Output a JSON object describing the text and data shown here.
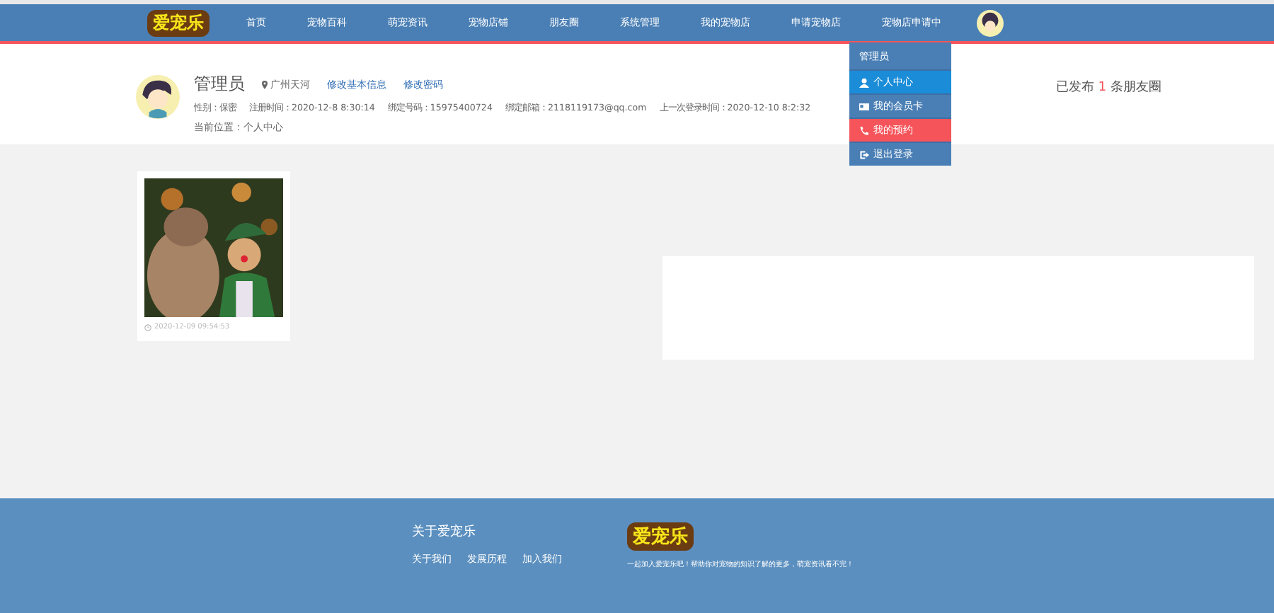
{
  "nav": {
    "logo": "爱宠乐",
    "items": [
      {
        "label": "首页",
        "selected": false
      },
      {
        "label": "宠物百科",
        "selected": false
      },
      {
        "label": "萌宠资讯",
        "selected": false
      },
      {
        "label": "宠物店铺",
        "selected": false
      },
      {
        "label": "朋友圈",
        "selected": false
      },
      {
        "label": "系统管理",
        "selected": false
      },
      {
        "label": "我的宠物店",
        "selected": false
      },
      {
        "label": "申请宠物店",
        "selected": false
      },
      {
        "label": "宠物店申请中",
        "selected": false
      }
    ]
  },
  "user_menu": {
    "title": "管理员",
    "items": [
      {
        "label": "个人中心",
        "color": "#1a8cd8"
      },
      {
        "label": "我的会员卡",
        "color": "#4a7fb5"
      },
      {
        "label": "我的预约",
        "color": "#f5545a"
      },
      {
        "label": "退出登录",
        "color": "#4a7fb5"
      }
    ]
  },
  "profile": {
    "name": "管理员",
    "location": "广州天河",
    "links": [
      "修改基本信息",
      "修改密码"
    ],
    "details": [
      "性别：保密",
      "注册时间：2020-12-8 8:30:14",
      "绑定号码：15975400724",
      "绑定邮箱：2118119173@qq.com",
      "上一次登录时间：2020-12-10 8:2:32"
    ],
    "breadcrumb": "当前位置：个人中心",
    "posts_summary": {
      "before": "已发布",
      "count": "1",
      "after": "条朋友圈"
    }
  },
  "posts": [
    {
      "kind": "picture",
      "time": "2020-12-09 09:54:53"
    }
  ],
  "footer": {
    "title": "关于爱宠乐",
    "links": [
      "关于我们",
      "发展历程",
      "加入我们"
    ],
    "logo": "爱宠乐",
    "tagline": "一起加入爱宠乐吧！帮助你对宠物的知识了解的更多，萌宠资讯看不完！"
  }
}
